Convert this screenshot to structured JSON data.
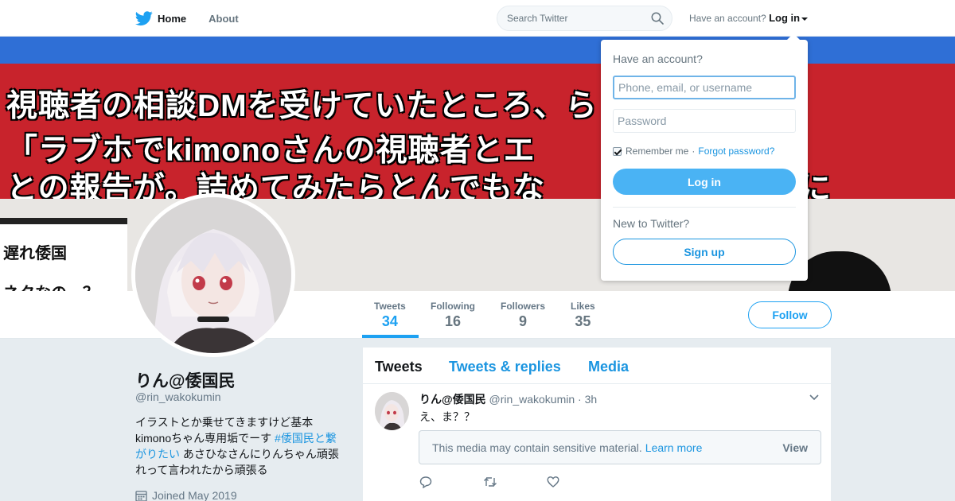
{
  "nav": {
    "home_label": "Home",
    "about_label": "About",
    "search_placeholder": "Search Twitter",
    "have_account_text": "Have an account?",
    "login_label": "Log in"
  },
  "banner": {
    "line1": "視聴者の相談DMを受けていたところ、ら",
    "line2": "「ラブホでkimonoさんの視聴者とエ　　　　　　w」",
    "line3": "との報告が。詰めてみたらとんでもな　　　　　ることに",
    "side1": "遅れ倭国",
    "side2": "ネタなの…？"
  },
  "login_dropdown": {
    "title": "Have an account?",
    "username_placeholder": "Phone, email, or username",
    "password_placeholder": "Password",
    "remember_label": "Remember me",
    "separator": "·",
    "forgot_label": "Forgot password?",
    "login_button": "Log in",
    "new_text": "New to Twitter?",
    "signup_button": "Sign up"
  },
  "stats": [
    {
      "label": "Tweets",
      "value": "34"
    },
    {
      "label": "Following",
      "value": "16"
    },
    {
      "label": "Followers",
      "value": "9"
    },
    {
      "label": "Likes",
      "value": "35"
    }
  ],
  "follow_button": "Follow",
  "profile": {
    "name": "りん@倭国民",
    "handle": "@rin_wakokumin",
    "bio_part1": "イラストとか乗せてきますけど基本kimonoちゃん専用垢でーす ",
    "bio_hashtag": "#倭国民と繋がりたい",
    "bio_part2": " あさひなさんにりんちゃん頑張れって言われたから頑張る",
    "joined": "Joined May 2019"
  },
  "timeline": {
    "tabs": [
      "Tweets",
      "Tweets & replies",
      "Media"
    ],
    "tweet": {
      "name": "りん@倭国民",
      "handle": "@rin_wakokumin",
      "separator": "·",
      "time": "3h",
      "text": "え、ま？？",
      "sensitive_text": "This media may contain sensitive material.",
      "learn_more": "Learn more",
      "view_label": "View"
    }
  },
  "colors": {
    "accent": "#1da1f2",
    "link": "#1b95e0",
    "login_button": "#4ab3f4",
    "banner_red": "#c8232c",
    "banner_blue": "#2f6fd6"
  },
  "icons": [
    "twitter-bird-icon",
    "home-icon",
    "search-icon",
    "caret-down-icon",
    "calendar-icon",
    "chevron-down-icon",
    "reply-icon",
    "retweet-icon",
    "like-icon"
  ]
}
